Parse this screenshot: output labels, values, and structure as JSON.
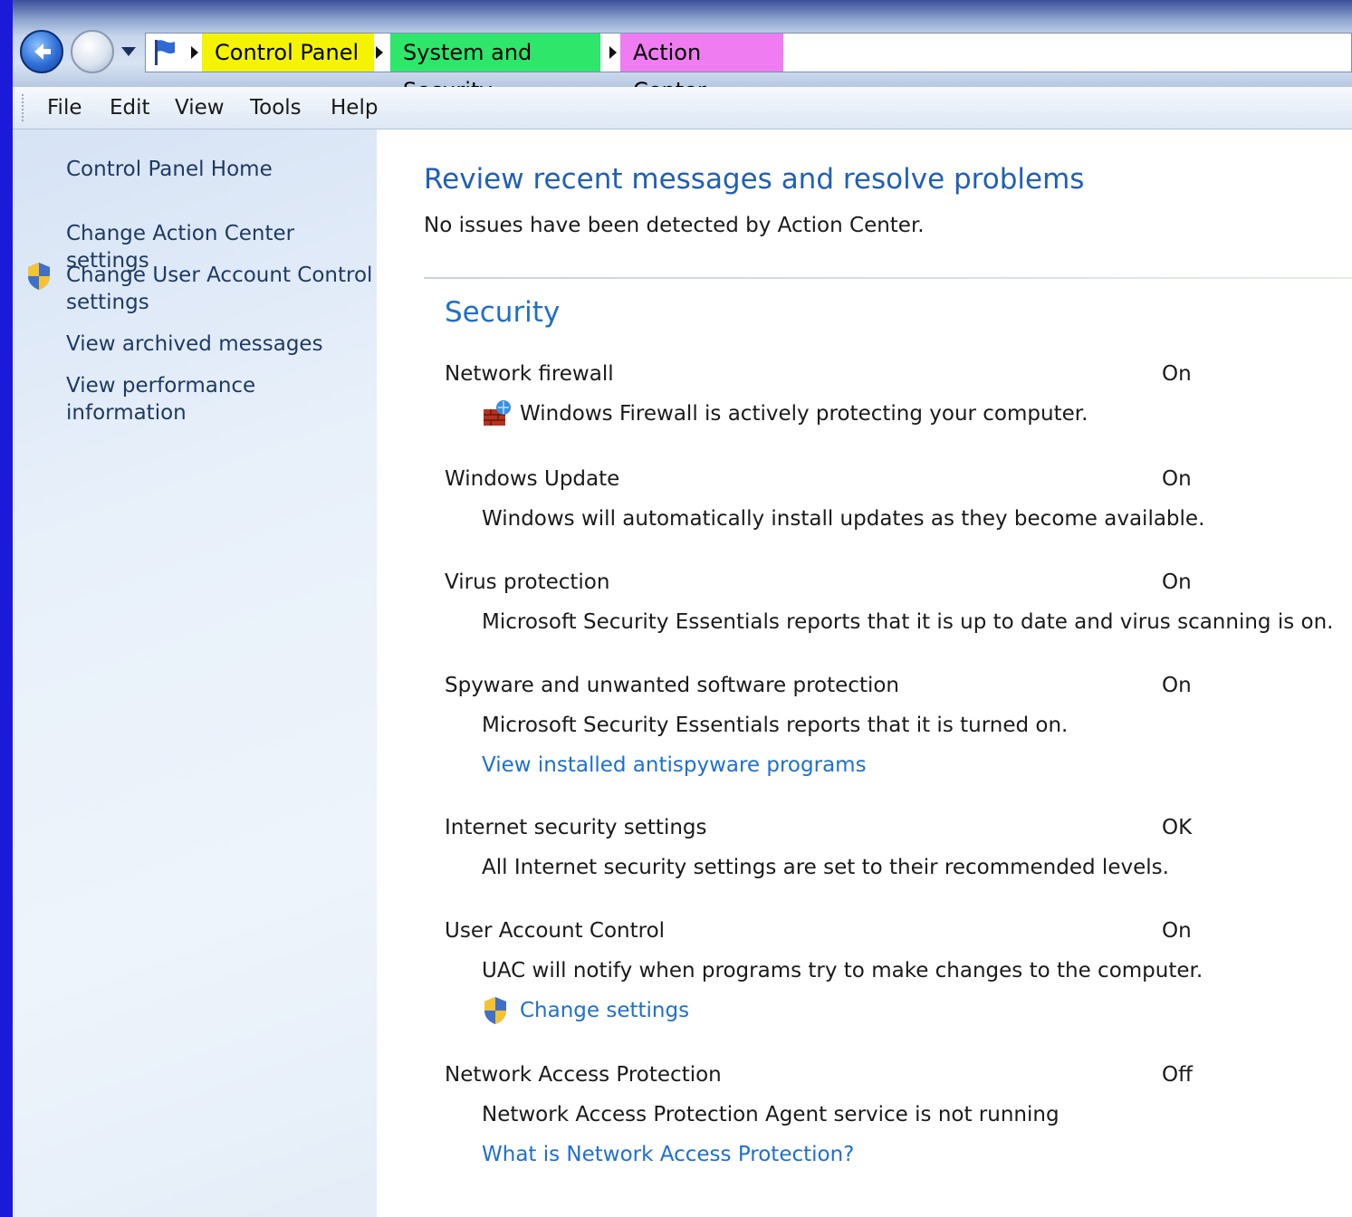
{
  "breadcrumb": {
    "items": [
      {
        "label": "Control Panel",
        "highlight": "#f4f400"
      },
      {
        "label": "System and Security",
        "highlight": "#2ee66a"
      },
      {
        "label": "Action Center",
        "highlight": "#f07cf2"
      }
    ]
  },
  "menu": {
    "items": [
      "File",
      "Edit",
      "View",
      "Tools",
      "Help"
    ]
  },
  "sidebar": {
    "items": [
      {
        "label": "Control Panel Home"
      },
      {
        "label": "Change Action Center settings"
      },
      {
        "label": "Change User Account Control settings",
        "icon": "uac-shield-icon"
      },
      {
        "label": "View archived messages"
      },
      {
        "label": "View performance information"
      }
    ]
  },
  "main": {
    "title": "Review recent messages and resolve problems",
    "subtitle": "No issues have been detected by Action Center.",
    "security": {
      "title": "Security",
      "items": [
        {
          "name": "Network firewall",
          "status": "On",
          "description": "Windows Firewall is actively protecting your computer.",
          "icon": "firewall-icon"
        },
        {
          "name": "Windows Update",
          "status": "On",
          "description": "Windows will automatically install updates as they become available."
        },
        {
          "name": "Virus protection",
          "status": "On",
          "description": "Microsoft Security Essentials reports that it is up to date and virus scanning is on."
        },
        {
          "name": "Spyware and unwanted software protection",
          "status": "On",
          "description": "Microsoft Security Essentials reports that it is turned on.",
          "link": "View installed antispyware programs"
        },
        {
          "name": "Internet security settings",
          "status": "OK",
          "description": "All Internet security settings are set to their recommended levels."
        },
        {
          "name": "User Account Control",
          "status": "On",
          "description": "UAC will notify when programs try to make changes to the computer.",
          "link": "Change settings",
          "link_icon": "uac-shield-icon"
        },
        {
          "name": "Network Access Protection",
          "status": "Off",
          "description": "Network Access Protection Agent service is not running",
          "link": "What is Network Access Protection?"
        }
      ]
    }
  },
  "colors": {
    "accent": "#1f5fb8",
    "link": "#1e6fd0",
    "frame": "#1a1ad8"
  }
}
